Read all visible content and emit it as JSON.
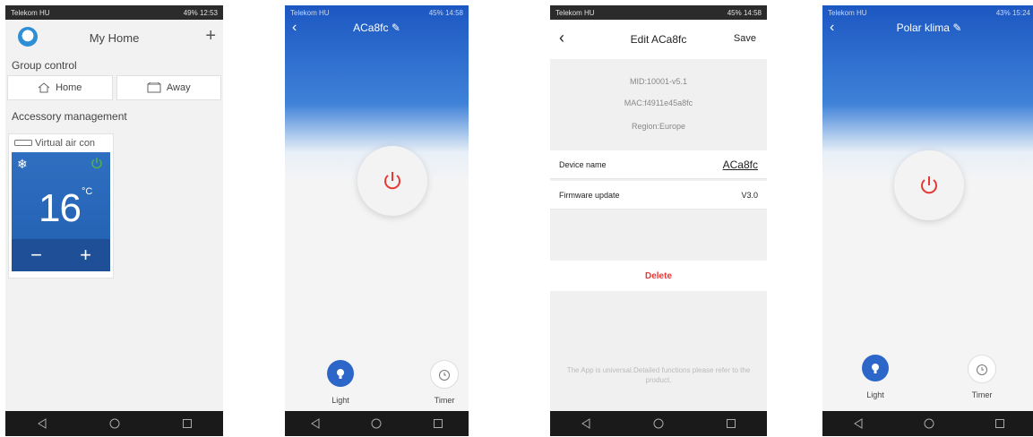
{
  "screen1": {
    "status": {
      "carrier": "Telekom HU",
      "right": "49% 12:53"
    },
    "title": "My Home",
    "group_control_label": "Group control",
    "home_label": "Home",
    "away_label": "Away",
    "accessory_label": "Accessory management",
    "device_name": "Virtual air con",
    "temperature": "16",
    "unit": "°C",
    "minus": "−",
    "plus": "+"
  },
  "screen2": {
    "status": {
      "carrier": "Telekom HU",
      "right": "45% 14:58"
    },
    "title": "ACa8fc",
    "light_label": "Light",
    "timer_label": "Timer"
  },
  "screen3": {
    "status": {
      "carrier": "Telekom HU",
      "right": "45% 14:58"
    },
    "title": "Edit  ACa8fc",
    "save_label": "Save",
    "mid": "MID:10001-v5.1",
    "mac": "MAC:f4911e45a8fc",
    "region": "Region:Europe",
    "device_name_label": "Device name",
    "device_name_value": "ACa8fc",
    "firmware_label": "Firmware update",
    "firmware_value": "V3.0",
    "delete_label": "Delete",
    "footer": "The App is universal.Detailed functions please refer to the product."
  },
  "screen4": {
    "status": {
      "carrier": "Telekom HU",
      "right": "43% 15:24"
    },
    "title": "Polar klima",
    "light_label": "Light",
    "timer_label": "Timer"
  },
  "colors": {
    "accent_blue": "#2c66c8",
    "power_red": "#e53935",
    "power_green": "#4caf50",
    "delete_red": "#e53935"
  }
}
